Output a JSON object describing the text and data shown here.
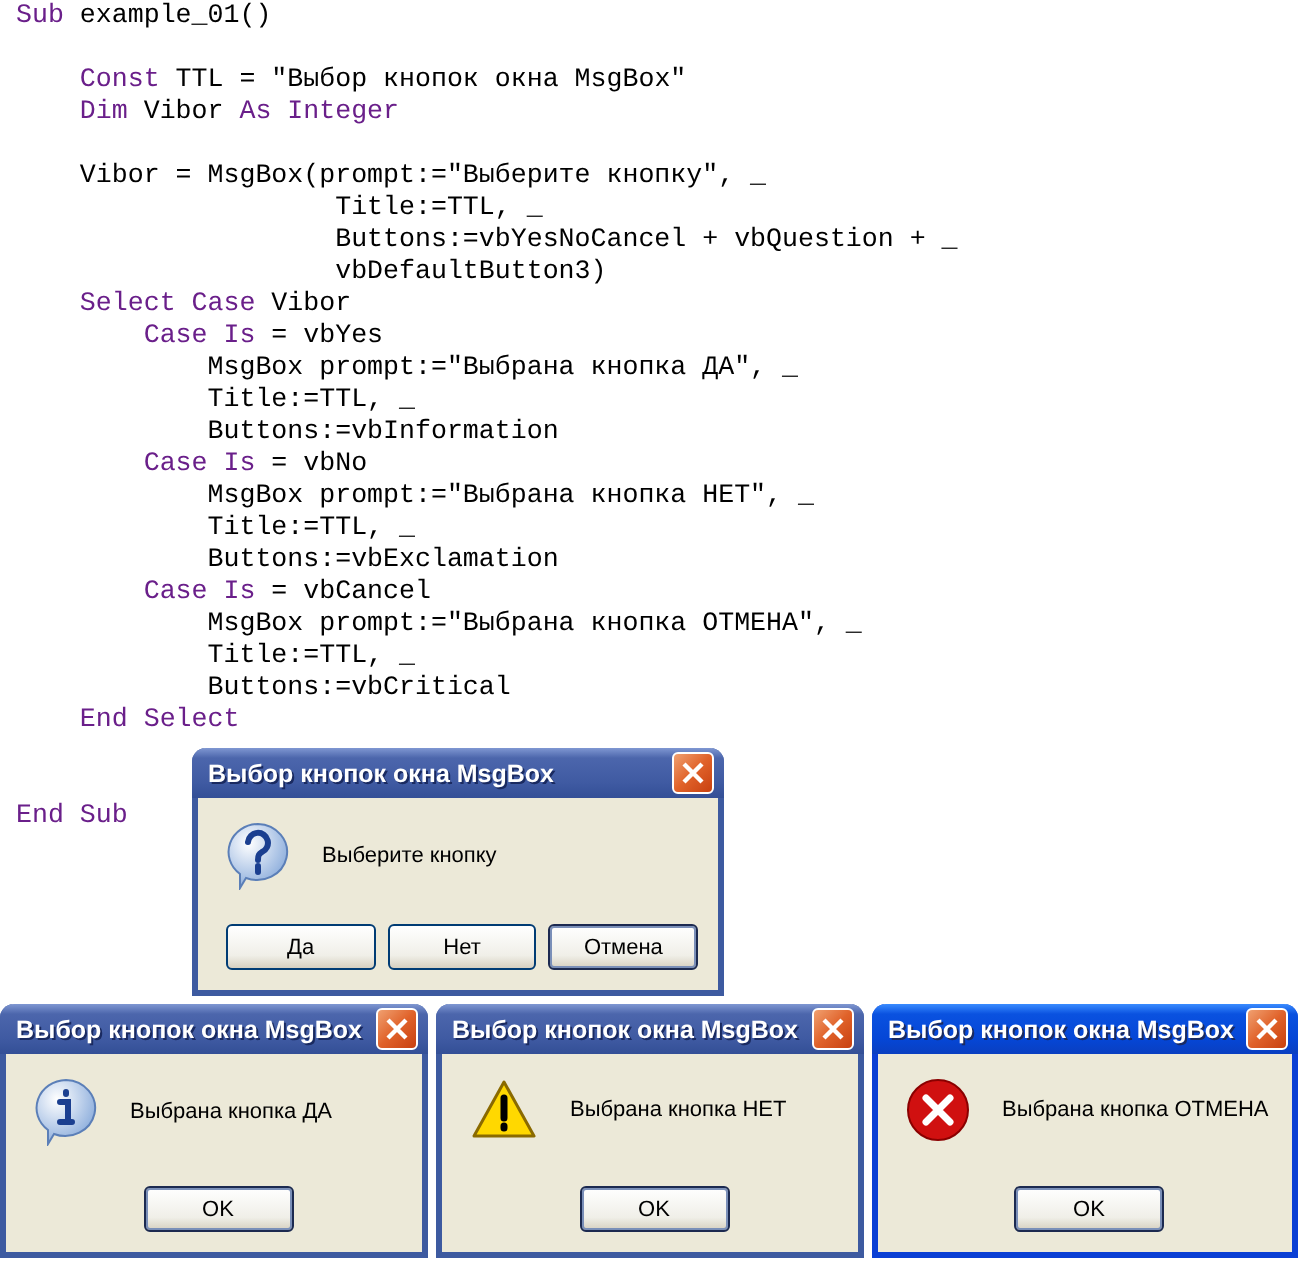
{
  "code": {
    "lines": [
      {
        "kind": "code",
        "tokens": [
          {
            "kind": "keyword",
            "text": "Sub"
          },
          {
            "kind": "plain",
            "text": " example_01()"
          }
        ]
      },
      {
        "kind": "blank"
      },
      {
        "kind": "code",
        "tokens": [
          {
            "kind": "keyword",
            "text": "    Const"
          },
          {
            "kind": "plain",
            "text": " TTL = \"Выбор кнопок окна MsgBox\""
          }
        ]
      },
      {
        "kind": "code",
        "tokens": [
          {
            "kind": "keyword",
            "text": "    Dim"
          },
          {
            "kind": "plain",
            "text": " Vibor "
          },
          {
            "kind": "keyword",
            "text": "As Integer"
          }
        ]
      },
      {
        "kind": "blank"
      },
      {
        "kind": "code",
        "tokens": [
          {
            "kind": "plain",
            "text": "    Vibor = MsgBox(prompt:=\"Выберите кнопку\", _"
          }
        ]
      },
      {
        "kind": "code",
        "tokens": [
          {
            "kind": "plain",
            "text": "                    Title:=TTL, _"
          }
        ]
      },
      {
        "kind": "code",
        "tokens": [
          {
            "kind": "plain",
            "text": "                    Buttons:=vbYesNoCancel + vbQuestion + _"
          }
        ]
      },
      {
        "kind": "code",
        "tokens": [
          {
            "kind": "plain",
            "text": "                    vbDefaultButton3)"
          }
        ]
      },
      {
        "kind": "code",
        "tokens": [
          {
            "kind": "keyword",
            "text": "    Select Case"
          },
          {
            "kind": "plain",
            "text": " Vibor"
          }
        ]
      },
      {
        "kind": "code",
        "tokens": [
          {
            "kind": "keyword",
            "text": "        Case Is"
          },
          {
            "kind": "plain",
            "text": " = vbYes"
          }
        ]
      },
      {
        "kind": "code",
        "tokens": [
          {
            "kind": "plain",
            "text": "            MsgBox prompt:=\"Выбрана кнопка ДА\", _"
          }
        ]
      },
      {
        "kind": "code",
        "tokens": [
          {
            "kind": "plain",
            "text": "            Title:=TTL, _"
          }
        ]
      },
      {
        "kind": "code",
        "tokens": [
          {
            "kind": "plain",
            "text": "            Buttons:=vbInformation"
          }
        ]
      },
      {
        "kind": "code",
        "tokens": [
          {
            "kind": "keyword",
            "text": "        Case Is"
          },
          {
            "kind": "plain",
            "text": " = vbNo"
          }
        ]
      },
      {
        "kind": "code",
        "tokens": [
          {
            "kind": "plain",
            "text": "            MsgBox prompt:=\"Выбрана кнопка НЕТ\", _"
          }
        ]
      },
      {
        "kind": "code",
        "tokens": [
          {
            "kind": "plain",
            "text": "            Title:=TTL, _"
          }
        ]
      },
      {
        "kind": "code",
        "tokens": [
          {
            "kind": "plain",
            "text": "            Buttons:=vbExclamation"
          }
        ]
      },
      {
        "kind": "code",
        "tokens": [
          {
            "kind": "keyword",
            "text": "        Case Is"
          },
          {
            "kind": "plain",
            "text": " = vbCancel"
          }
        ]
      },
      {
        "kind": "code",
        "tokens": [
          {
            "kind": "plain",
            "text": "            MsgBox prompt:=\"Выбрана кнопка ОТМЕНА\", _"
          }
        ]
      },
      {
        "kind": "code",
        "tokens": [
          {
            "kind": "plain",
            "text": "            Title:=TTL, _"
          }
        ]
      },
      {
        "kind": "code",
        "tokens": [
          {
            "kind": "plain",
            "text": "            Buttons:=vbCritical"
          }
        ]
      },
      {
        "kind": "code",
        "tokens": [
          {
            "kind": "keyword",
            "text": "    End Select"
          }
        ]
      },
      {
        "kind": "blank"
      },
      {
        "kind": "blank"
      },
      {
        "kind": "code",
        "tokens": [
          {
            "kind": "keyword",
            "text": "End Sub"
          }
        ]
      }
    ]
  },
  "dialogs": [
    {
      "title": "Выбор кнопок окна MsgBox",
      "active": false,
      "kind": "question",
      "message": "Выберите кнопку",
      "buttons": [
        {
          "label": "Да",
          "default": false
        },
        {
          "label": "Нет",
          "default": false
        },
        {
          "label": "Отмена",
          "default": true
        }
      ]
    },
    {
      "title": "Выбор кнопок окна MsgBox",
      "active": false,
      "kind": "information",
      "message": "Выбрана кнопка ДА",
      "buttons": [
        {
          "label": "OK",
          "default": true
        }
      ]
    },
    {
      "title": "Выбор кнопок окна MsgBox",
      "active": false,
      "kind": "warning",
      "message": "Выбрана кнопка НЕТ",
      "buttons": [
        {
          "label": "OK",
          "default": true
        }
      ]
    },
    {
      "title": "Выбор кнопок окна MsgBox",
      "active": true,
      "kind": "error",
      "message": "Выбрана кнопка ОТМЕНА",
      "buttons": [
        {
          "label": "OK",
          "default": true
        }
      ]
    }
  ]
}
